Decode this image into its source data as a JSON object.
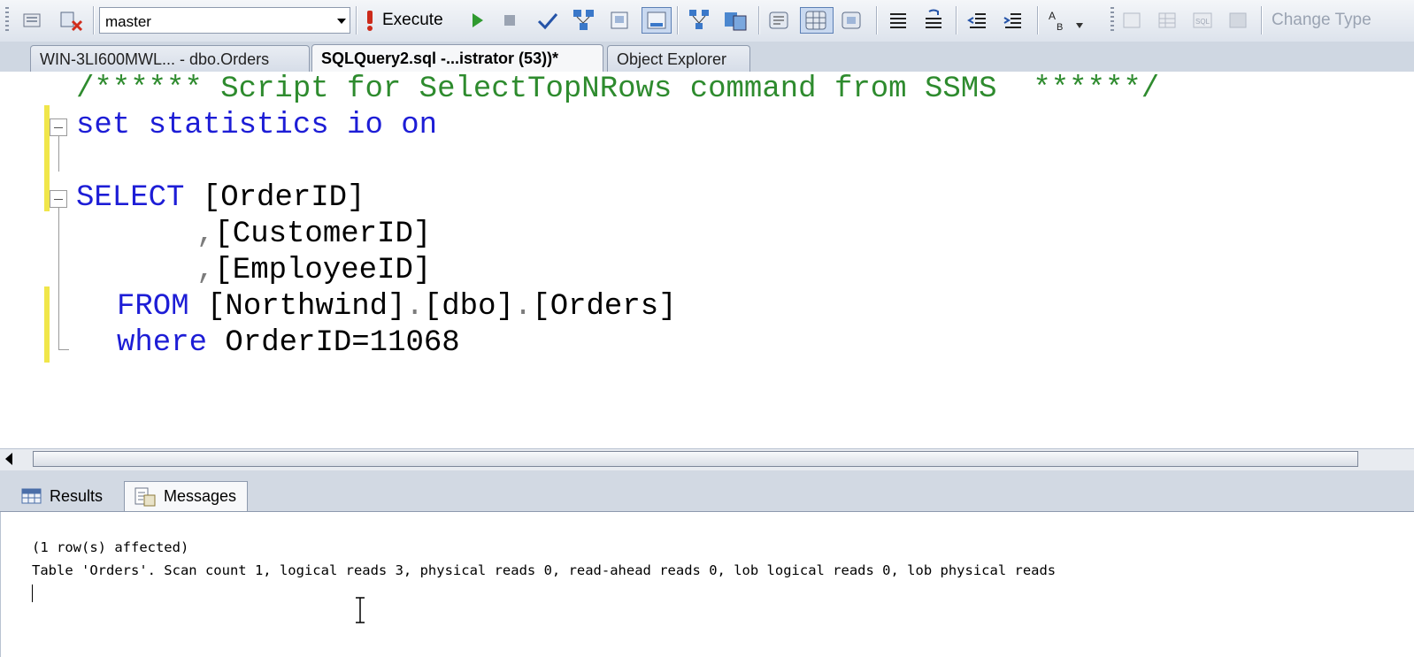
{
  "toolbar": {
    "database": "master",
    "execute_label": "Execute",
    "change_type_label": "Change Type",
    "icons": [
      "query-options-icon",
      "disconnect-icon",
      "execute-icon",
      "debug-icon",
      "stop-icon",
      "parse-icon",
      "display-estimated-plan-icon",
      "query-designer-icon",
      "results-to-file-icon",
      "include-plan-icon",
      "client-stats-icon",
      "results-to-text-icon",
      "results-to-grid-icon",
      "results-to-file2-icon",
      "comment-icon",
      "uncomment-icon",
      "decrease-indent-icon",
      "increase-indent-icon",
      "specify-template-values-icon"
    ],
    "colors": {
      "execute_red": "#cc2a1a",
      "execute_green": "#2f9a2f"
    }
  },
  "tabs": [
    {
      "label": "WIN-3LI600MWL... - dbo.Orders",
      "active": false
    },
    {
      "label": "SQLQuery2.sql -...istrator (53))*",
      "active": true
    },
    {
      "label": "Object Explorer",
      "active": false
    }
  ],
  "editor": {
    "line1": {
      "comment": "/****** Script for SelectTopNRows command from SSMS  ******/"
    },
    "line2": {
      "text": "set statistics io on"
    },
    "line4": {
      "kw": "SELECT",
      "rest": " [OrderID]"
    },
    "line5": {
      "comma": ",",
      "rest": "[CustomerID]"
    },
    "line6": {
      "comma": ",",
      "rest": "[EmployeeID]"
    },
    "line7": {
      "kw": "FROM",
      "rest": " [Northwind]",
      "dot1": ".",
      "mid": "[dbo]",
      "dot2": ".",
      "end": "[Orders]"
    },
    "line8": {
      "kw": "where",
      "rest": " OrderID=11068"
    },
    "colors": {
      "keyword": "#1d1dd6",
      "comment": "#2e8b2e",
      "change_bar": "#f0e64a"
    }
  },
  "results_tabs": [
    {
      "label": "Results",
      "active": false
    },
    {
      "label": "Messages",
      "active": true
    }
  ],
  "messages": {
    "line1": "(1 row(s) affected)",
    "line2": "Table 'Orders'. Scan count 1, logical reads 3, physical reads 0, read-ahead reads 0, lob logical reads 0, lob physical reads"
  }
}
